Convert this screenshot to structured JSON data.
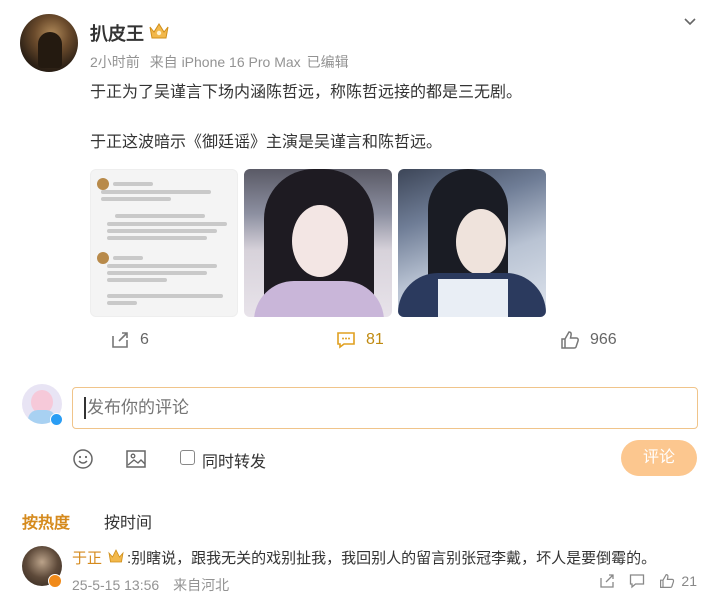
{
  "post": {
    "author": "扒皮王",
    "time": "2小时前",
    "source": "来自 iPhone 16 Pro Max",
    "edited": "已编辑",
    "paragraphs": [
      "于正为了吴谨言下场内涵陈哲远，称陈哲远接的都是三无剧。",
      "于正这波暗示《御廷谣》主演是吴谨言和陈哲远。"
    ]
  },
  "actions": {
    "repost_count": "6",
    "comment_count": "81",
    "like_count": "966"
  },
  "comment_input": {
    "placeholder": "发布你的评论"
  },
  "tools": {
    "repost_check_label": "同时转发",
    "submit_label": "评论"
  },
  "sort": {
    "hot_label": "按热度",
    "time_label": "按时间"
  },
  "comments": [
    {
      "name": "于正",
      "text": ":别瞎说，跟我无关的戏别扯我，我回别人的留言别张冠李戴，坏人是要倒霉的。",
      "time": "25-5-15 13:56",
      "location": "来自河北",
      "likes": "21"
    }
  ],
  "colors": {
    "accent": "#d58a1d",
    "submit": "#fcc78f",
    "input_border": "#f0c48a",
    "meta": "#939393"
  },
  "icons": [
    "crown-icon",
    "chevron-down-icon",
    "repost-icon",
    "comment-icon",
    "like-icon",
    "emoji-icon",
    "image-icon",
    "share-icon",
    "reply-icon"
  ]
}
